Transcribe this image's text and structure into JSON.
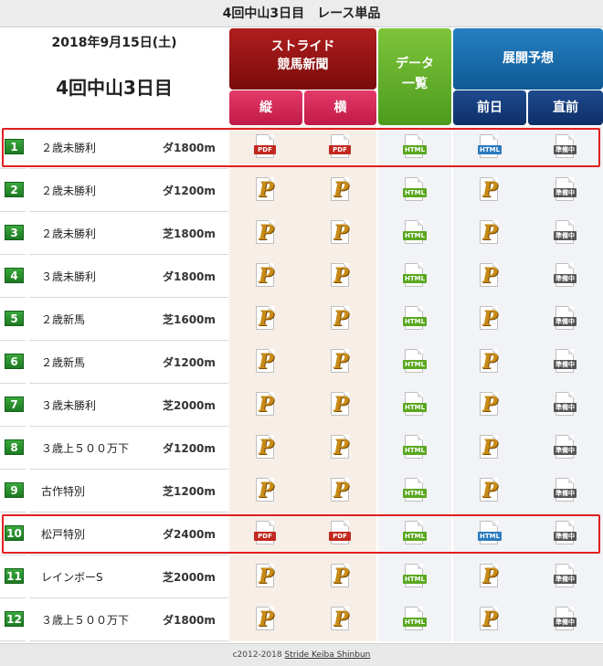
{
  "page_title": "4回中山3日目　レース単品",
  "info": {
    "date": "2018年9月15日(土)",
    "meeting": "4回中山3日目"
  },
  "headers": {
    "stride_line1": "ストライド",
    "stride_line2": "競馬新聞",
    "tate": "縦",
    "yoko": "横",
    "data_line1": "データ",
    "data_line2": "一覧",
    "tenkai": "展開予想",
    "zenjitsu": "前日",
    "chokuzen": "直前"
  },
  "icon_labels": {
    "pdf": "PDF",
    "html": "HTML",
    "preparing": "準備中"
  },
  "races": [
    {
      "num": "1",
      "name": "２歳未勝利",
      "dist": "ダ1800m",
      "available": true,
      "highlighted": true
    },
    {
      "num": "2",
      "name": "２歳未勝利",
      "dist": "ダ1200m",
      "available": false,
      "highlighted": false
    },
    {
      "num": "3",
      "name": "２歳未勝利",
      "dist": "芝1800m",
      "available": false,
      "highlighted": false
    },
    {
      "num": "4",
      "name": "３歳未勝利",
      "dist": "ダ1800m",
      "available": false,
      "highlighted": false
    },
    {
      "num": "5",
      "name": "２歳新馬",
      "dist": "芝1600m",
      "available": false,
      "highlighted": false
    },
    {
      "num": "6",
      "name": "２歳新馬",
      "dist": "ダ1200m",
      "available": false,
      "highlighted": false
    },
    {
      "num": "7",
      "name": "３歳未勝利",
      "dist": "芝2000m",
      "available": false,
      "highlighted": false
    },
    {
      "num": "8",
      "name": "３歳上５００万下",
      "dist": "ダ1200m",
      "available": false,
      "highlighted": false
    },
    {
      "num": "9",
      "name": "古作特別",
      "dist": "芝1200m",
      "available": false,
      "highlighted": false
    },
    {
      "num": "10",
      "name": "松戸特別",
      "dist": "ダ2400m",
      "available": true,
      "highlighted": true
    },
    {
      "num": "11",
      "name": "レインボーS",
      "dist": "芝2000m",
      "available": false,
      "highlighted": false
    },
    {
      "num": "12",
      "name": "３歳上５００万下",
      "dist": "ダ1800m",
      "available": false,
      "highlighted": false
    }
  ],
  "footer": {
    "copyright": "c2012-2018",
    "link_text": "Stride Keiba Shinbun"
  },
  "colors": {
    "highlight": "#e02020",
    "stride_header": "#8b1010",
    "data_header": "#5aa720",
    "tenkai_header": "#1670b0"
  }
}
